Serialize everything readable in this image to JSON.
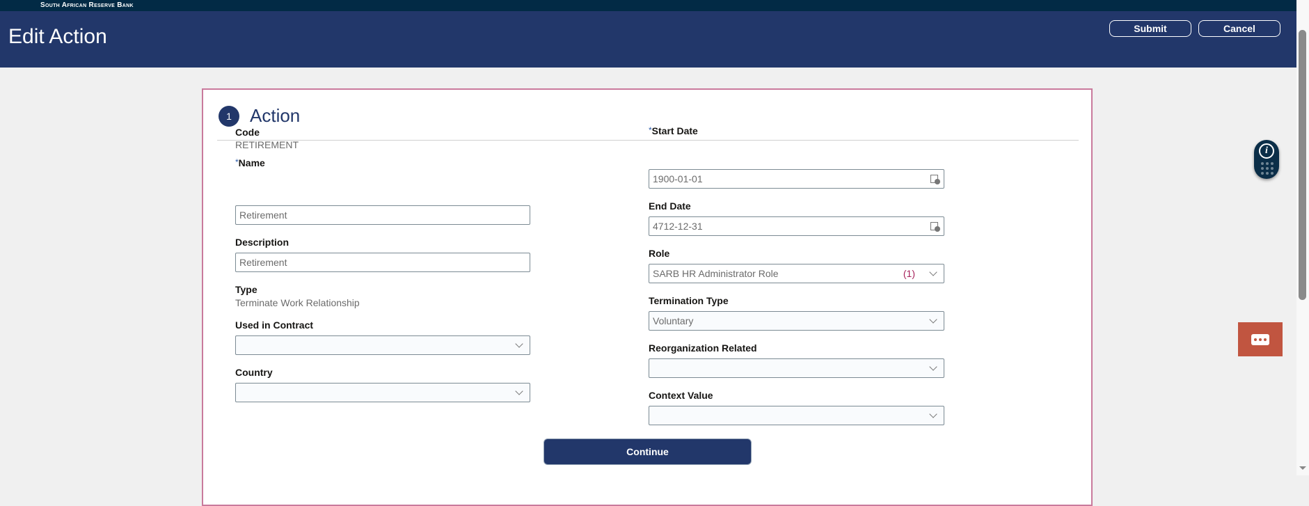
{
  "brand": "South African Reserve Bank",
  "header": {
    "title": "Edit Action",
    "submit_label": "Submit",
    "cancel_label": "Cancel"
  },
  "section": {
    "number": "1",
    "title": "Action"
  },
  "left": {
    "code_label": "Code",
    "code_value": "RETIREMENT",
    "name_label": "Name",
    "name_value": "Retirement",
    "description_label": "Description",
    "description_value": "Retirement",
    "type_label": "Type",
    "type_value": "Terminate Work Relationship",
    "used_in_contract_label": "Used in Contract",
    "used_in_contract_value": "",
    "country_label": "Country",
    "country_value": ""
  },
  "right": {
    "start_date_label": "Start Date",
    "start_date_value": "1900-01-01",
    "end_date_label": "End Date",
    "end_date_value": "4712-12-31",
    "role_label": "Role",
    "role_value": "SARB HR Administrator Role",
    "role_count": "(1)",
    "termination_type_label": "Termination Type",
    "termination_type_value": "Voluntary",
    "reorganization_label": "Reorganization Related",
    "reorganization_value": "",
    "context_value_label": "Context Value",
    "context_value_value": ""
  },
  "continue_label": "Continue",
  "required_marker": "*"
}
